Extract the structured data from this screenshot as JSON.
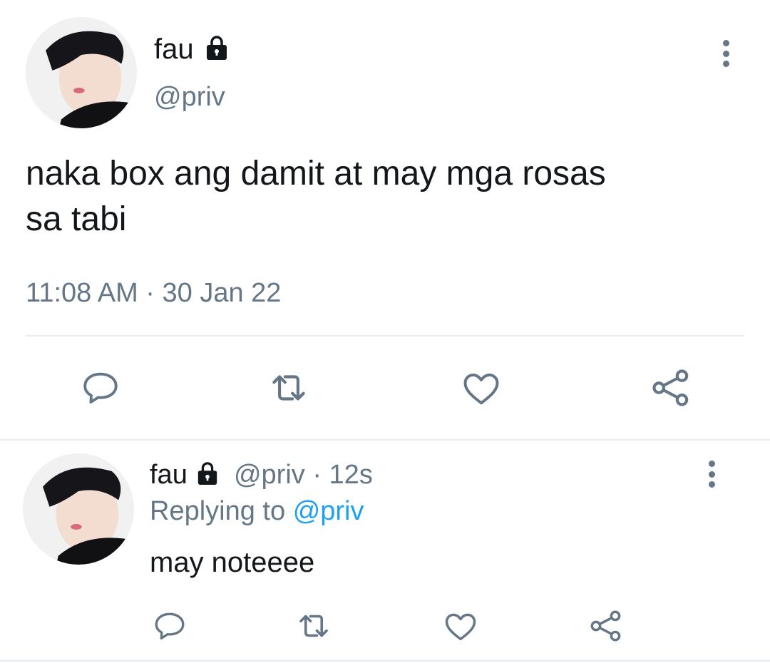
{
  "colors": {
    "text": "#14171a",
    "muted": "#657786",
    "accent": "#1da1f2",
    "divider": "#e6ecf0"
  },
  "main_tweet": {
    "display_name": "fau",
    "handle": "@priv",
    "text_line1": "naka box ang damit at may mga rosas",
    "text_line2": "sa tabi",
    "timestamp": "11:08 AM · 30 Jan 22",
    "icons": [
      "lock-icon",
      "more-icon",
      "reply-icon",
      "retweet-icon",
      "like-icon",
      "share-icon"
    ]
  },
  "reply_tweet": {
    "display_name": "fau",
    "handle": "@priv",
    "separator": "·",
    "time": "12s",
    "replying_label": "Replying to",
    "replying_handle": "@priv",
    "text": "may noteeee",
    "icons": [
      "lock-icon",
      "more-icon",
      "reply-icon",
      "retweet-icon",
      "like-icon",
      "share-icon"
    ]
  }
}
